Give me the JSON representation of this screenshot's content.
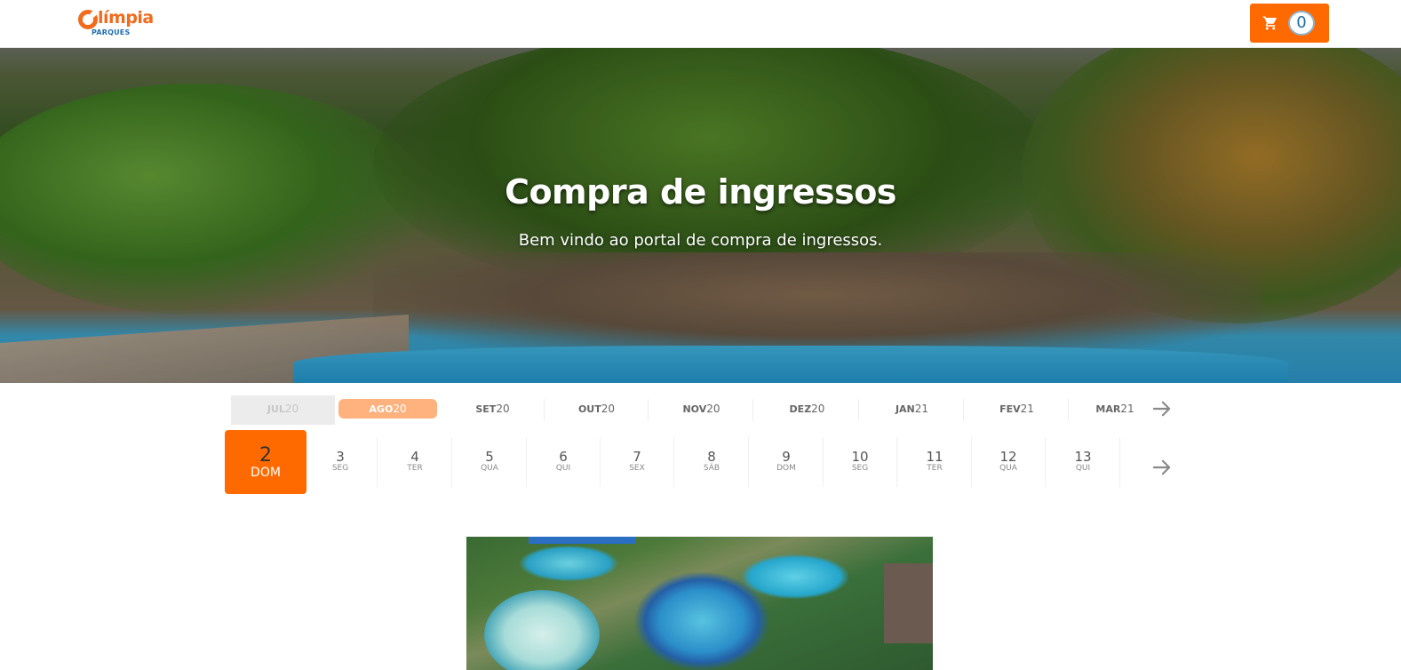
{
  "header": {
    "logo": {
      "brand_word": "límpia",
      "brand_sub": "PARQUES"
    },
    "cart": {
      "icon": "cart-icon",
      "count": "0"
    }
  },
  "hero": {
    "title": "Compra de ingressos",
    "subtitle": "Bem vindo ao portal de compra de ingressos."
  },
  "months": [
    {
      "abbr": "JUL",
      "year": "20",
      "state": "disabled"
    },
    {
      "abbr": "AGO",
      "year": "20",
      "state": "active"
    },
    {
      "abbr": "SET",
      "year": "20",
      "state": "normal"
    },
    {
      "abbr": "OUT",
      "year": "20",
      "state": "normal"
    },
    {
      "abbr": "NOV",
      "year": "20",
      "state": "normal"
    },
    {
      "abbr": "DEZ",
      "year": "20",
      "state": "normal"
    },
    {
      "abbr": "JAN",
      "year": "21",
      "state": "normal"
    },
    {
      "abbr": "FEV",
      "year": "21",
      "state": "normal"
    },
    {
      "abbr": "MAR",
      "year": "21",
      "state": "normal"
    }
  ],
  "days": [
    {
      "num": "2",
      "dow": "DOM",
      "selected": true
    },
    {
      "num": "3",
      "dow": "SEG"
    },
    {
      "num": "4",
      "dow": "TER"
    },
    {
      "num": "5",
      "dow": "QUA"
    },
    {
      "num": "6",
      "dow": "QUI"
    },
    {
      "num": "7",
      "dow": "SEX"
    },
    {
      "num": "8",
      "dow": "SÁB"
    },
    {
      "num": "9",
      "dow": "DOM"
    },
    {
      "num": "10",
      "dow": "SEG"
    },
    {
      "num": "11",
      "dow": "TER"
    },
    {
      "num": "12",
      "dow": "QUA"
    },
    {
      "num": "13",
      "dow": "QUI"
    }
  ],
  "icons": {
    "months_next": "arrow-right-icon",
    "days_next": "arrow-right-icon"
  },
  "colors": {
    "accent": "#ff6a00",
    "month_active": "#ffb27e",
    "logo_orange": "#f26b1d",
    "logo_blue": "#1f6fb2"
  }
}
